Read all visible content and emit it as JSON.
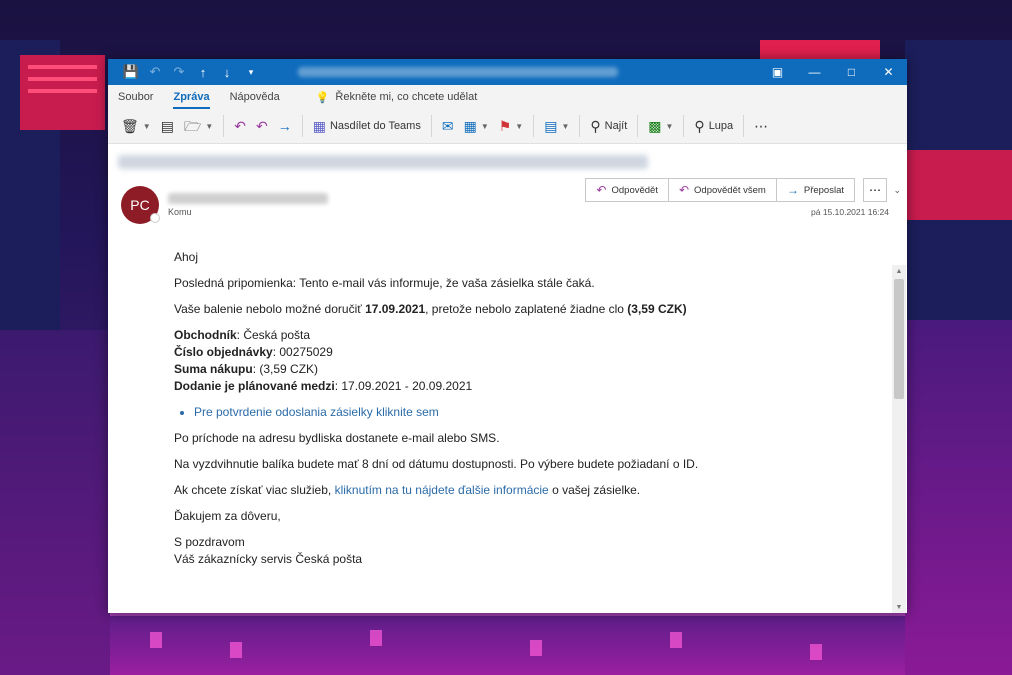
{
  "titlebar": {
    "icons": [
      "save-icon",
      "undo-icon",
      "redo-icon",
      "arrow-up-icon",
      "arrow-down-icon",
      "customize-icon"
    ],
    "controls": [
      "ribbon-display-icon",
      "minimize-icon",
      "maximize-icon",
      "close-icon"
    ],
    "accent": "#0f6cbd"
  },
  "menu": {
    "tabs": [
      "Soubor",
      "Zpráva",
      "Nápověda"
    ],
    "active_tab": "Zpráva",
    "tell_me": "Řekněte mi, co chcete udělat"
  },
  "ribbon": {
    "teams_label": "Nasdílet do Teams",
    "find_label": "Najít",
    "zoom_label": "Lupa"
  },
  "header": {
    "avatar_initials": "PC",
    "avatar_color": "#8e1c27",
    "to_label": "Komu",
    "reply_label": "Odpovědět",
    "reply_all_label": "Odpovědět všem",
    "forward_label": "Přeposlat",
    "date": "pá 15.10.2021 16:24"
  },
  "body": {
    "greeting": "Ahoj",
    "reminder": "Posledná pripomienka: Tento e-mail vás informuje, že vaša zásielka stále čaká.",
    "delivery_pre": "Vaše balenie nebolo možné doručiť ",
    "delivery_date": "17.09.2021",
    "delivery_mid": ", pretože nebolo zaplatené žiadne clo ",
    "delivery_amount": "(3,59 CZK)",
    "merchant_label": "Obchodník",
    "merchant_value": ": Česká pošta",
    "order_label": "Číslo objednávky",
    "order_value": ": 00275029",
    "sum_label": "Suma nákupu",
    "sum_value": ": (3,59 CZK)",
    "planned_label": "Dodanie je plánované medzi",
    "planned_value": ": 17.09.2021 - 20.09.2021",
    "confirm_link": "Pre potvrdenie odoslania zásielky kliknite sem",
    "arrival": "Po príchode na adresu bydliska dostanete e-mail alebo SMS.",
    "pickup": "Na vyzdvihnutie balíka budete mať 8 dní od dátumu dostupnosti. Po výbere budete požiadaní o ID.",
    "more_pre": "Ak chcete získať viac služieb, ",
    "more_link": "kliknutím na tu nájdete ďalšie informácie",
    "more_post": " o vašej zásielke.",
    "thanks": "Ďakujem za dôveru,",
    "regards": "S pozdravom",
    "signature": "Váš zákaznícky servis Česká pošta"
  }
}
